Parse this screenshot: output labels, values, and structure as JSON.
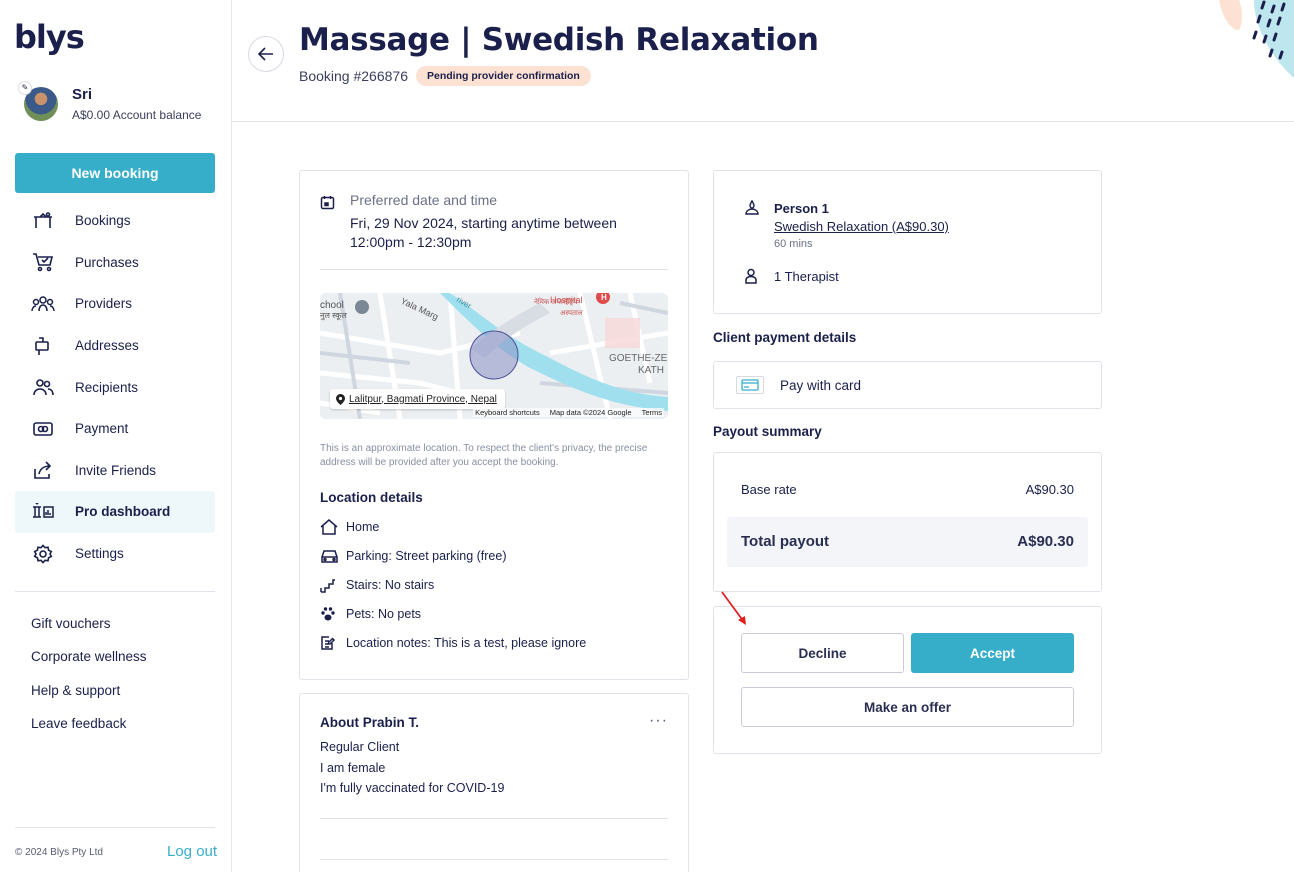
{
  "brand": {
    "logo": "blys"
  },
  "profile": {
    "name": "Sri",
    "balance": "A$0.00 Account balance"
  },
  "sidebar": {
    "new_booking": "New booking",
    "items": [
      {
        "label": "Bookings",
        "icon": "massage-table-icon"
      },
      {
        "label": "Purchases",
        "icon": "cart-icon"
      },
      {
        "label": "Providers",
        "icon": "providers-icon"
      },
      {
        "label": "Addresses",
        "icon": "mailbox-icon"
      },
      {
        "label": "Recipients",
        "icon": "users-icon"
      },
      {
        "label": "Payment",
        "icon": "payment-icon"
      },
      {
        "label": "Invite Friends",
        "icon": "share-icon"
      },
      {
        "label": "Pro dashboard",
        "icon": "dashboard-icon",
        "active": true
      },
      {
        "label": "Settings",
        "icon": "gear-icon"
      }
    ],
    "links": [
      "Gift vouchers",
      "Corporate wellness",
      "Help & support",
      "Leave feedback"
    ],
    "copyright": "© 2024 Blys Pty Ltd",
    "logout": "Log out"
  },
  "header": {
    "title": "Massage | Swedish Relaxation",
    "booking_number": "Booking #266876",
    "status": "Pending provider confirmation"
  },
  "booking": {
    "preferred_label": "Preferred date and time",
    "preferred_value": "Fri, 29 Nov 2024, starting anytime between 12:00pm - 12:30pm",
    "map": {
      "address": "Lalitpur, Bagmati Province, Nepal",
      "labels": {
        "school": "chool",
        "school_np": "नुल स्कूल",
        "road": "Yala Marg",
        "river": "river",
        "hospital": "Hospital",
        "hospital_np": "नेमिक अन्तर्राष्ट्रिय",
        "hospital_np2": "अस्पताल",
        "goethe": "GOETHE-ZE",
        "kath": "KATH"
      },
      "credits": [
        "Keyboard shortcuts",
        "Map data ©2024 Google",
        "Terms"
      ]
    },
    "privacy_note": "This is an approximate location. To respect the client's privacy, the precise address will be provided after you accept the booking.",
    "location_heading": "Location details",
    "location_items": [
      {
        "text": "Home",
        "icon": "home-icon"
      },
      {
        "text": "Parking: Street parking (free)",
        "icon": "car-icon"
      },
      {
        "text": "Stairs: No stairs",
        "icon": "stairs-icon"
      },
      {
        "text": "Pets: No pets",
        "icon": "paw-icon"
      },
      {
        "text": "Location notes: This is a test, please ignore",
        "icon": "notes-icon"
      }
    ]
  },
  "about": {
    "title": "About Prabin T.",
    "more": "···",
    "lines": [
      "Regular Client",
      "I am female",
      "I'm fully vaccinated for COVID-19"
    ]
  },
  "service": {
    "person": "Person 1",
    "treatment": "Swedish Relaxation (A$90.30)",
    "duration": "60 mins",
    "therapists": "1 Therapist"
  },
  "payment": {
    "section_title": "Client payment details",
    "method": "Pay with card"
  },
  "payout": {
    "section_title": "Payout summary",
    "base_label": "Base rate",
    "base_value": "A$90.30",
    "total_label": "Total payout",
    "total_value": "A$90.30"
  },
  "actions": {
    "decline": "Decline",
    "accept": "Accept",
    "offer": "Make an offer"
  },
  "colors": {
    "accent": "#37aec9",
    "navy": "#1a1f4b",
    "badge": "#fde2d4"
  }
}
